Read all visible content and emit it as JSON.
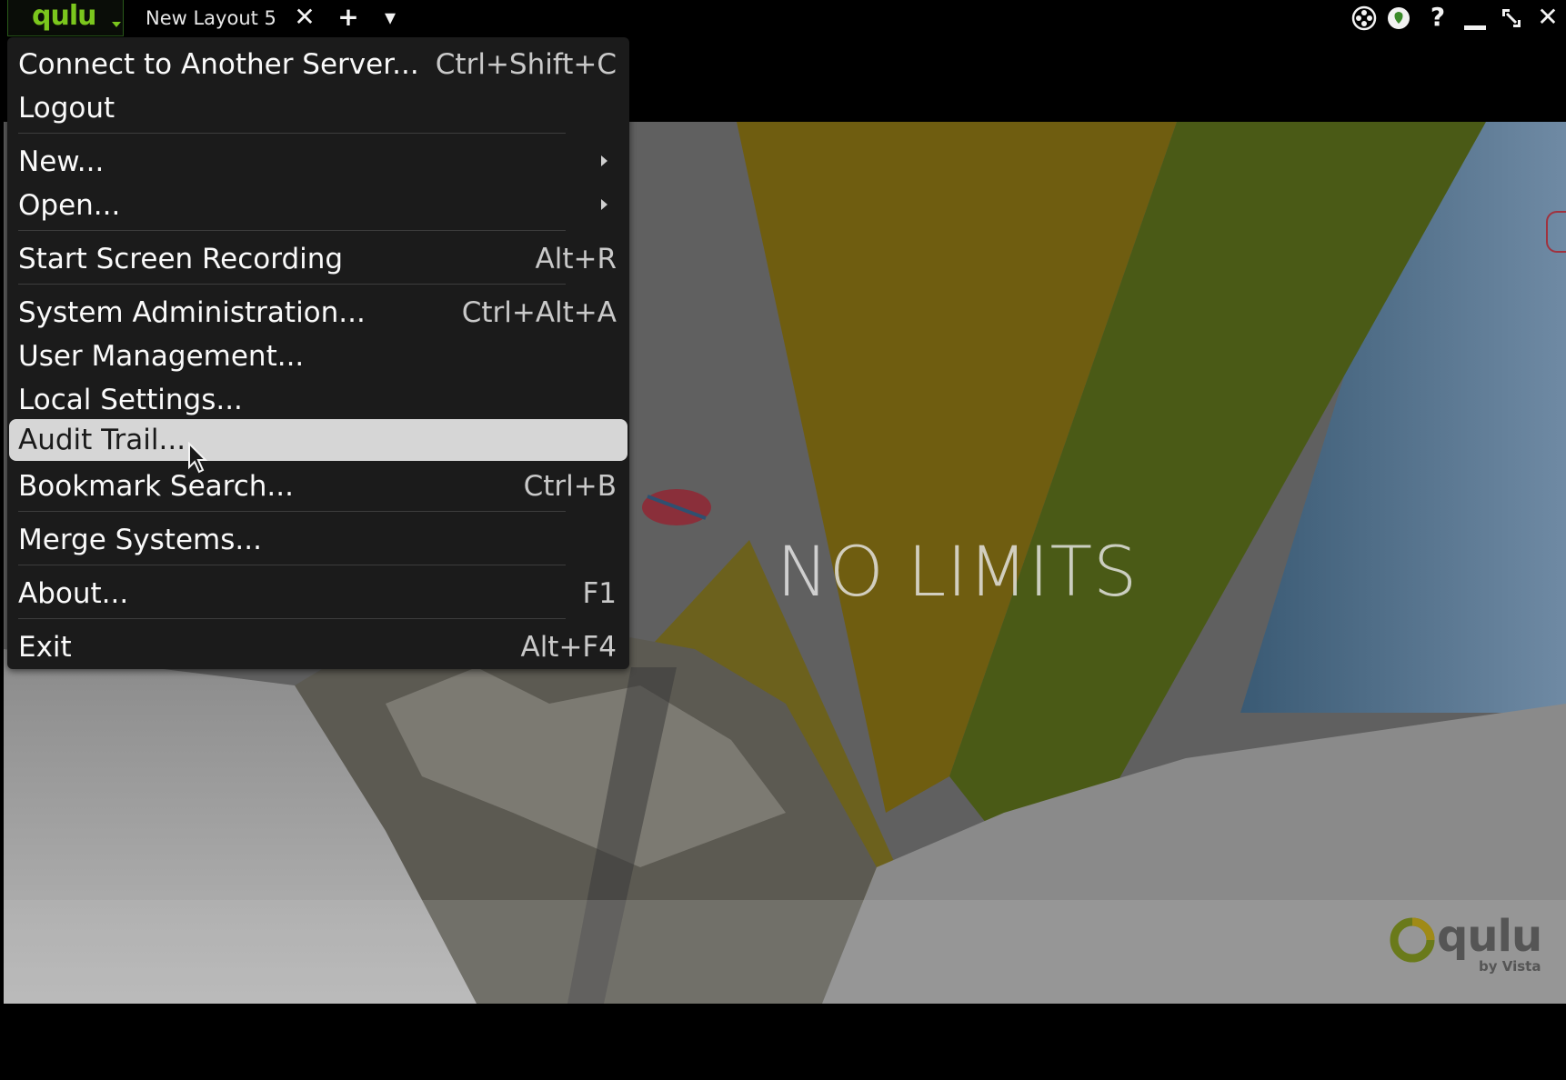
{
  "titlebar": {
    "app_logo": "qulu",
    "tab_label": "New Layout 5",
    "tab_close_glyph": "✕",
    "new_tab_glyph": "+",
    "tabs_menu_glyph": "▾",
    "help_glyph": "?",
    "close_glyph": "✕"
  },
  "background": {
    "headline": "NO LIMITS",
    "brand": "qulu",
    "brand_sub": "by Vista"
  },
  "menu": {
    "items": [
      {
        "label": "Connect to Another Server...",
        "shortcut": "Ctrl+Shift+C"
      },
      {
        "label": "Logout",
        "shortcut": ""
      },
      {
        "label": "New...",
        "shortcut": "",
        "submenu": true
      },
      {
        "label": "Open...",
        "shortcut": "",
        "submenu": true
      },
      {
        "label": "Start Screen Recording",
        "shortcut": "Alt+R"
      },
      {
        "label": "System Administration...",
        "shortcut": "Ctrl+Alt+A"
      },
      {
        "label": "User Management...",
        "shortcut": ""
      },
      {
        "label": "Local Settings...",
        "shortcut": ""
      },
      {
        "label": "Audit Trail...",
        "shortcut": "",
        "highlighted": true
      },
      {
        "label": "Bookmark Search...",
        "shortcut": "Ctrl+B"
      },
      {
        "label": "Merge Systems...",
        "shortcut": ""
      },
      {
        "label": "About...",
        "shortcut": "F1"
      },
      {
        "label": "Exit",
        "shortcut": "Alt+F4"
      }
    ]
  },
  "colors": {
    "brand_green": "#7bc61d",
    "menu_bg": "#1b1b1b",
    "menu_highlight": "#d6d6d6"
  }
}
